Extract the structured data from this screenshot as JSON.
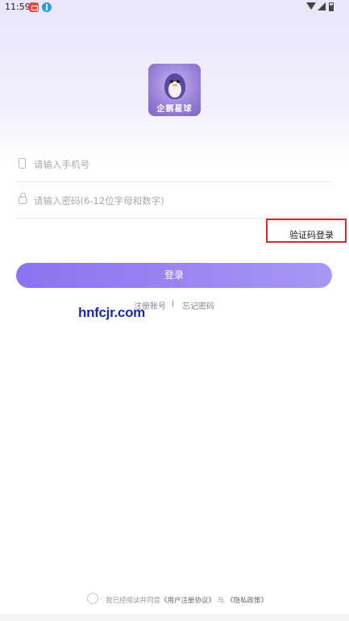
{
  "status_bar": {
    "time": "11:59"
  },
  "app": {
    "logo_text": "企鹅星球"
  },
  "login_form": {
    "phone_placeholder": "请输入手机号",
    "password_placeholder": "请输入密码(6-12位字母和数字)",
    "sms_login_label": "验证码登录",
    "login_button_label": "登录",
    "register_label": "注册账号",
    "divider": "|",
    "forgot_label": "忘记密码"
  },
  "watermark": "hnfcjr.com",
  "agreement": {
    "prefix": "我已经阅读并同意",
    "user_agreement": "《用户注册协议》",
    "conjunction": "与",
    "privacy_policy": "《隐私政策》"
  },
  "colors": {
    "accent_start": "#8b72f0",
    "accent_end": "#a897f3",
    "highlight_border": "#d42a2a"
  }
}
